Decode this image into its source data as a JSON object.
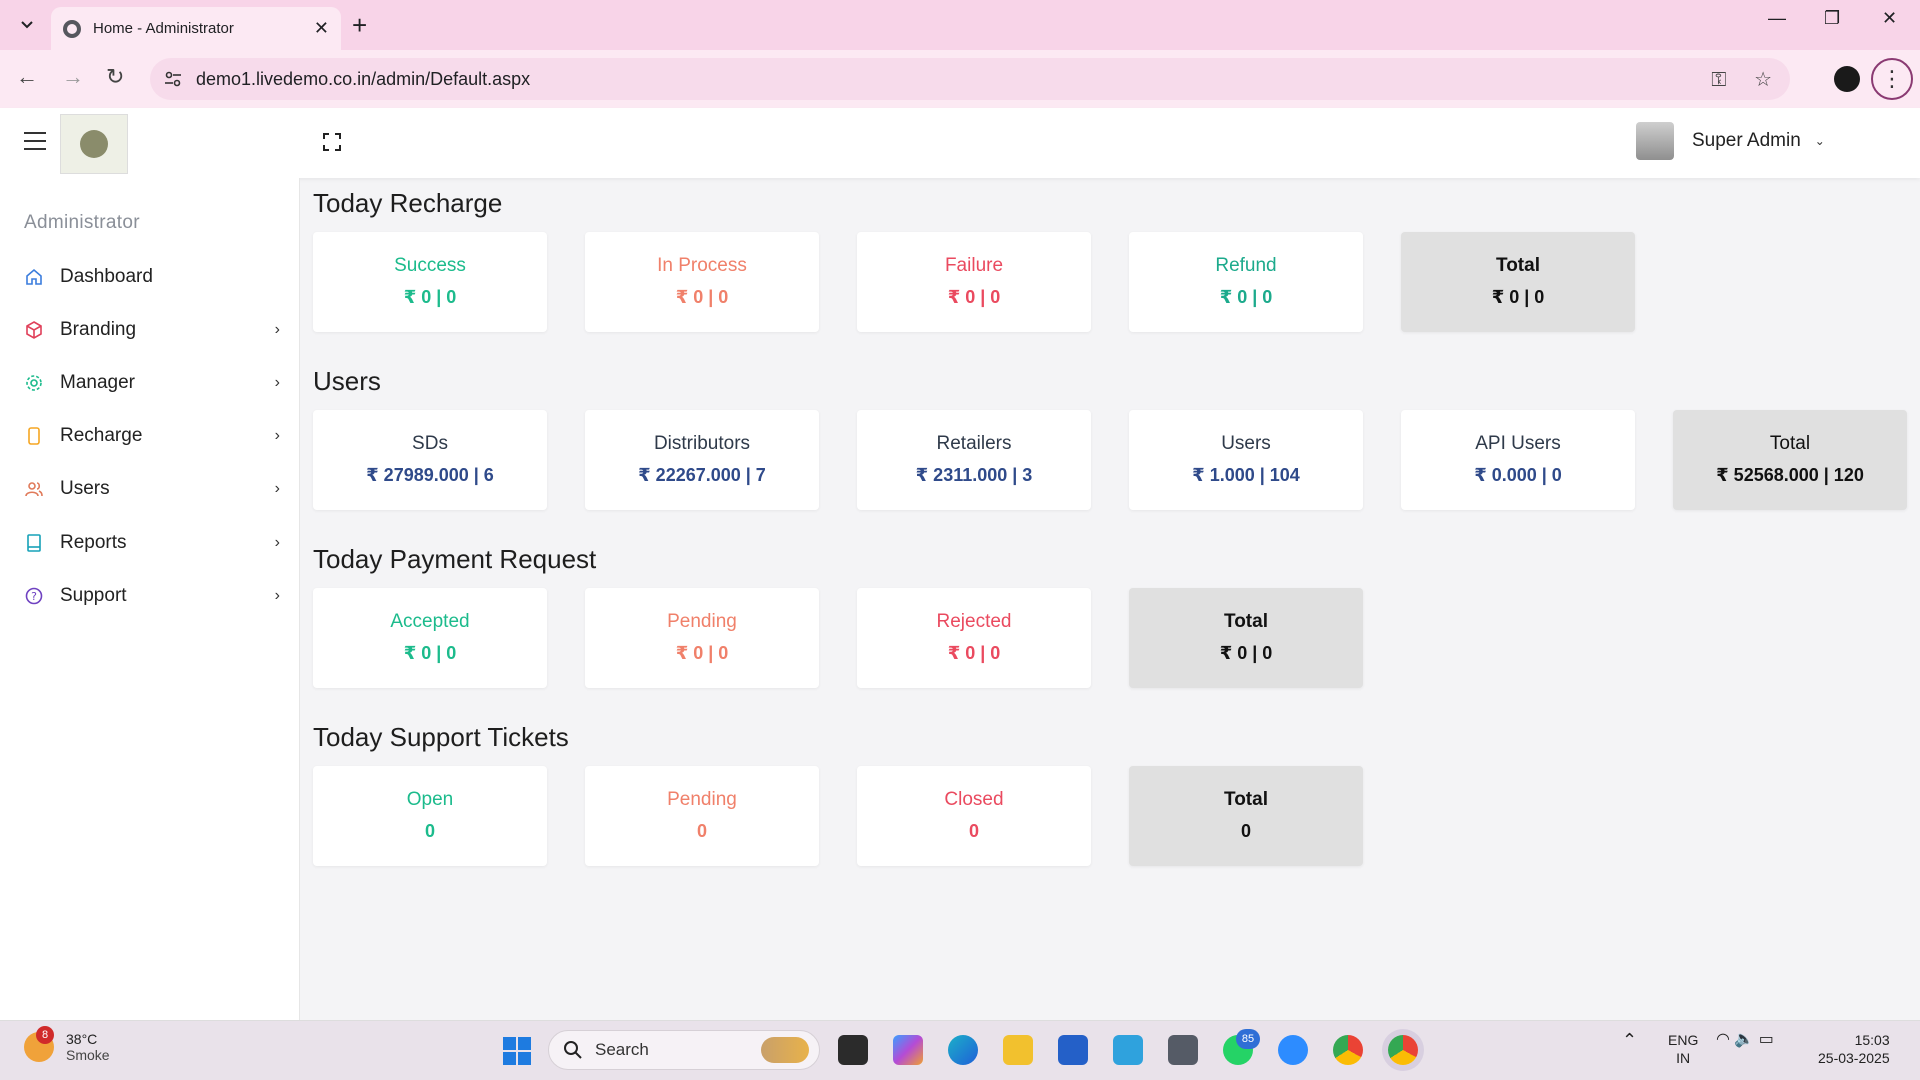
{
  "browser": {
    "tab_title": "Home - Administrator",
    "url": "demo1.livedemo.co.in/admin/Default.aspx"
  },
  "header": {
    "user_name": "Super Admin"
  },
  "sidebar": {
    "heading": "Administrator",
    "items": [
      {
        "label": "Dashboard",
        "icon": "home-icon",
        "color": "#3b7ddd"
      },
      {
        "label": "Branding",
        "icon": "box-icon",
        "color": "#e0405a"
      },
      {
        "label": "Manager",
        "icon": "gear-icon",
        "color": "#1cbb8c"
      },
      {
        "label": "Recharge",
        "icon": "phone-icon",
        "color": "#f5a623"
      },
      {
        "label": "Users",
        "icon": "users-icon",
        "color": "#e07a5a"
      },
      {
        "label": "Reports",
        "icon": "book-icon",
        "color": "#17a2b8"
      },
      {
        "label": "Support",
        "icon": "help-circle-icon",
        "color": "#6f42c1"
      }
    ]
  },
  "sections": {
    "recharge": {
      "title": "Today Recharge",
      "cards": [
        {
          "label": "Success",
          "value": "₹ 0 | 0"
        },
        {
          "label": "In Process",
          "value": "₹ 0 | 0"
        },
        {
          "label": "Failure",
          "value": "₹ 0 | 0"
        },
        {
          "label": "Refund",
          "value": "₹ 0 | 0"
        },
        {
          "label": "Total",
          "value": "₹ 0 | 0"
        }
      ]
    },
    "users": {
      "title": "Users",
      "cards": [
        {
          "label": "SDs",
          "value": "₹ 27989.000 | 6"
        },
        {
          "label": "Distributors",
          "value": "₹ 22267.000 | 7"
        },
        {
          "label": "Retailers",
          "value": "₹ 2311.000 | 3"
        },
        {
          "label": "Users",
          "value": "₹ 1.000 | 104"
        },
        {
          "label": "API Users",
          "value": "₹ 0.000 | 0"
        },
        {
          "label": "Total",
          "value": "₹ 52568.000 | 120"
        }
      ]
    },
    "payment": {
      "title": "Today Payment Request",
      "cards": [
        {
          "label": "Accepted",
          "value": "₹ 0 | 0"
        },
        {
          "label": "Pending",
          "value": "₹ 0 | 0"
        },
        {
          "label": "Rejected",
          "value": "₹ 0 | 0"
        },
        {
          "label": "Total",
          "value": "₹ 0 | 0"
        }
      ]
    },
    "support": {
      "title": "Today Support Tickets",
      "cards": [
        {
          "label": "Open",
          "value": "0"
        },
        {
          "label": "Pending",
          "value": "0"
        },
        {
          "label": "Closed",
          "value": "0"
        },
        {
          "label": "Total",
          "value": "0"
        }
      ]
    }
  },
  "colors": {
    "success": "#1cbb8c",
    "warning": "#f0806a",
    "danger": "#ea4a5f",
    "info": "#1cbb8c",
    "users_blue": "#2f4a8a",
    "total": "#111111"
  },
  "taskbar": {
    "weather_temp": "38°C",
    "weather_desc": "Smoke",
    "weather_badge": "8",
    "search_placeholder": "Search",
    "whatsapp_badge": "85",
    "lang_line1": "ENG",
    "lang_line2": "IN",
    "time": "15:03",
    "date": "25-03-2025"
  }
}
